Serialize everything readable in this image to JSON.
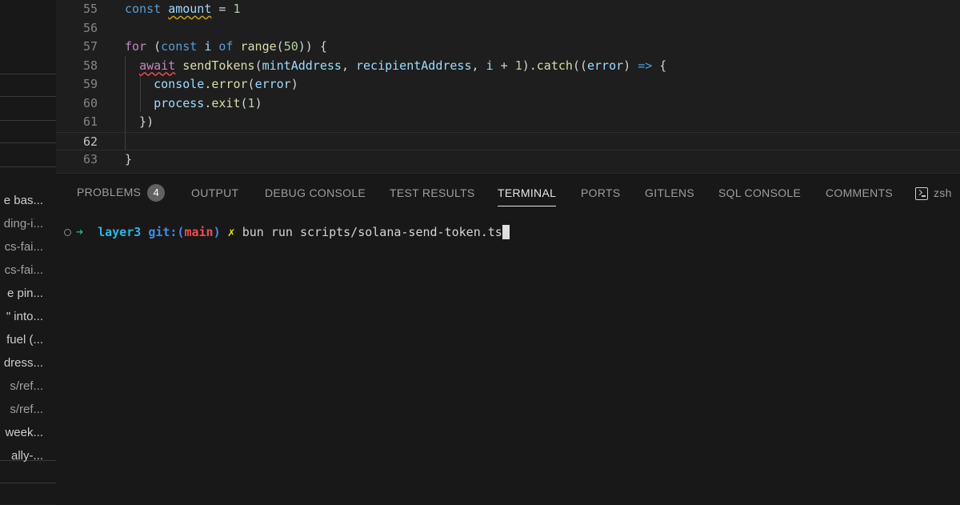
{
  "sidebar": {
    "items": [
      "e bas...",
      "ding-i...",
      "cs-fai...",
      "cs-fai...",
      "e pin...",
      "\" into...",
      "fuel (...",
      "dress...",
      "s/ref...",
      "s/ref...",
      "week...",
      "ally-..."
    ]
  },
  "editor": {
    "lines": [
      {
        "num": "55",
        "tokens": [
          [
            "kw",
            "const "
          ],
          [
            "var squig-y",
            "amount"
          ],
          [
            "txt",
            " = "
          ],
          [
            "num",
            "1"
          ]
        ]
      },
      {
        "num": "56",
        "tokens": []
      },
      {
        "num": "57",
        "tokens": [
          [
            "ctl",
            "for "
          ],
          [
            "txt",
            "("
          ],
          [
            "kw",
            "const "
          ],
          [
            "var",
            "i "
          ],
          [
            "kw",
            "of "
          ],
          [
            "fn",
            "range"
          ],
          [
            "txt",
            "("
          ],
          [
            "num",
            "50"
          ],
          [
            "txt",
            ")) {"
          ]
        ]
      },
      {
        "num": "58",
        "tokens": [
          [
            "txt",
            "  "
          ],
          [
            "ctl squig-r",
            "await"
          ],
          [
            "txt",
            " "
          ],
          [
            "fn",
            "sendTokens"
          ],
          [
            "txt",
            "("
          ],
          [
            "var",
            "mintAddress"
          ],
          [
            "txt",
            ", "
          ],
          [
            "var",
            "recipientAddress"
          ],
          [
            "txt",
            ", "
          ],
          [
            "var",
            "i"
          ],
          [
            "txt",
            " + "
          ],
          [
            "num",
            "1"
          ],
          [
            "txt",
            ")."
          ],
          [
            "fn",
            "catch"
          ],
          [
            "txt",
            "(("
          ],
          [
            "var",
            "error"
          ],
          [
            "txt",
            ") "
          ],
          [
            "kw",
            "=>"
          ],
          [
            "txt",
            " {"
          ]
        ]
      },
      {
        "num": "59",
        "tokens": [
          [
            "txt",
            "    "
          ],
          [
            "var",
            "console"
          ],
          [
            "txt",
            "."
          ],
          [
            "fn",
            "error"
          ],
          [
            "txt",
            "("
          ],
          [
            "var",
            "error"
          ],
          [
            "txt",
            ")"
          ]
        ]
      },
      {
        "num": "60",
        "tokens": [
          [
            "txt",
            "    "
          ],
          [
            "var",
            "process"
          ],
          [
            "txt",
            "."
          ],
          [
            "fn",
            "exit"
          ],
          [
            "txt",
            "("
          ],
          [
            "num",
            "1"
          ],
          [
            "txt",
            ")"
          ]
        ]
      },
      {
        "num": "61",
        "tokens": [
          [
            "txt",
            "  })"
          ]
        ]
      },
      {
        "num": "62",
        "tokens": [],
        "current": true
      },
      {
        "num": "63",
        "tokens": [
          [
            "txt",
            "}"
          ]
        ]
      }
    ]
  },
  "panel": {
    "tabs": {
      "problems": "PROBLEMS",
      "problems_count": "4",
      "output": "OUTPUT",
      "debug_console": "DEBUG CONSOLE",
      "test_results": "TEST RESULTS",
      "terminal": "TERMINAL",
      "ports": "PORTS",
      "gitlens": "GITLENS",
      "sql_console": "SQL CONSOLE",
      "comments": "COMMENTS",
      "shell": "zsh"
    },
    "terminal": {
      "prompt_arrow": "➜",
      "directory": "layer3",
      "git_label": "git:(",
      "branch": "main",
      "git_close": ")",
      "dirty_mark": "✗",
      "command": "bun run scripts/solana-send-token.ts"
    }
  }
}
